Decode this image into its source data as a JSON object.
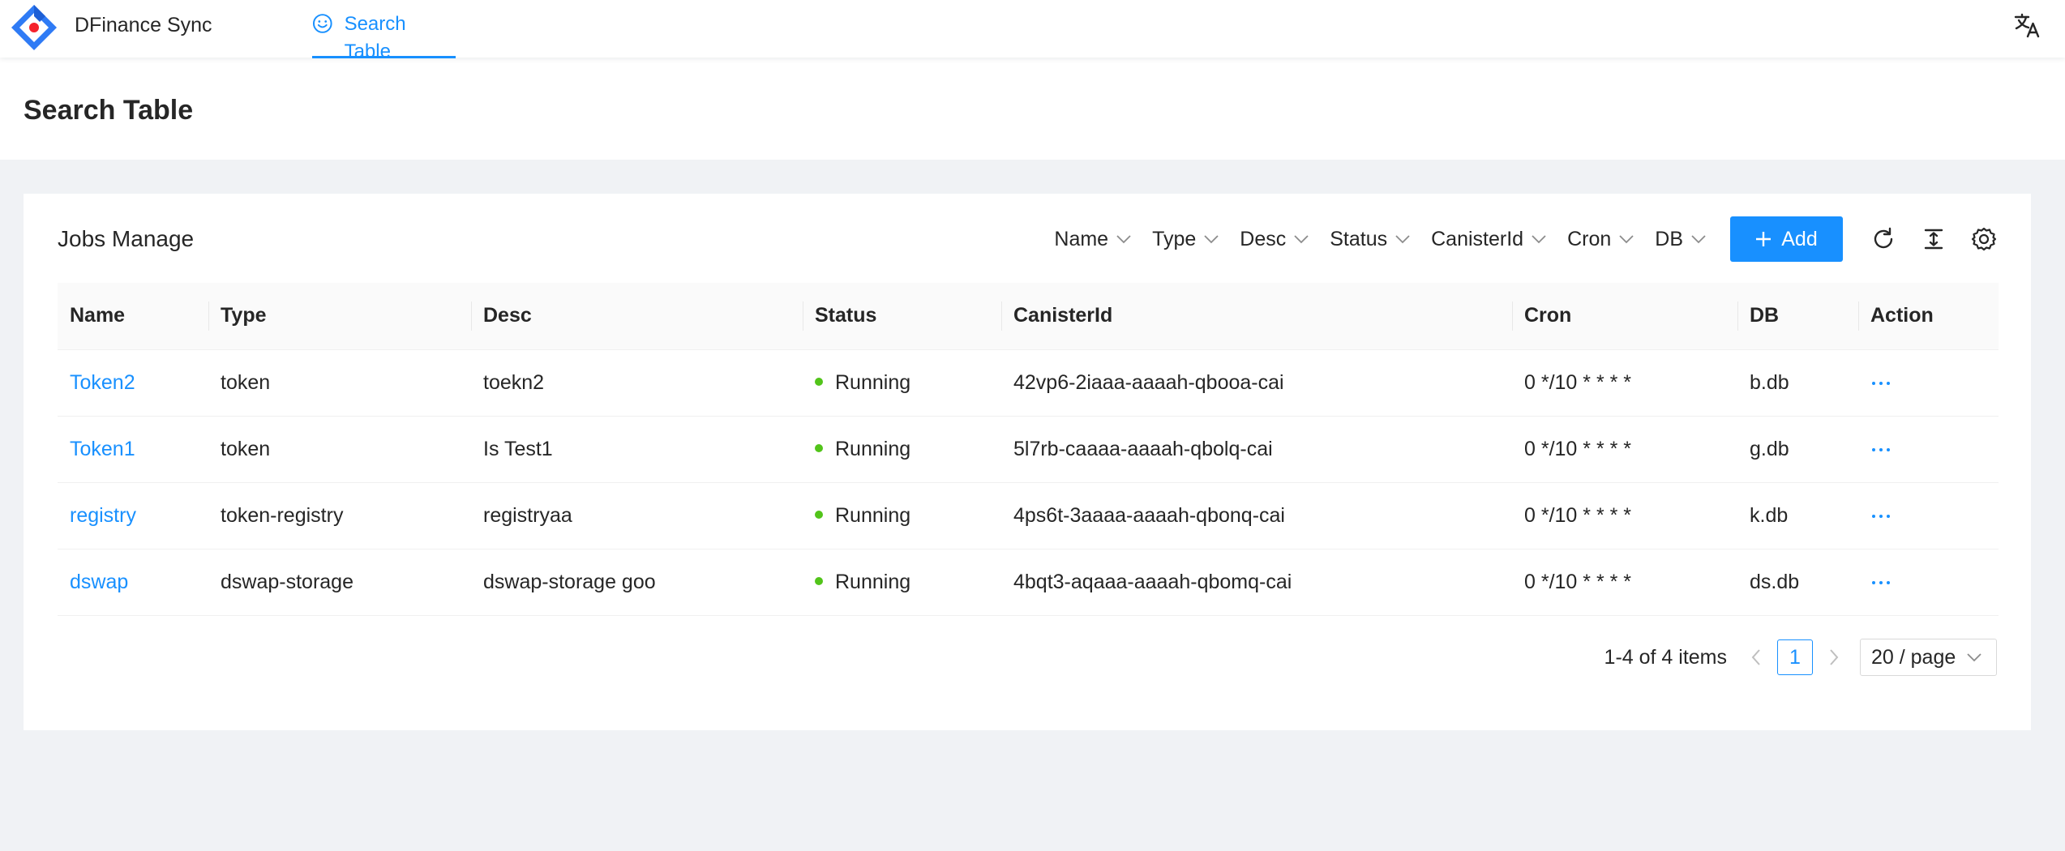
{
  "app": {
    "title": "DFinance Sync"
  },
  "nav": {
    "tabs": [
      {
        "label": "Search Table",
        "icon": "smile-icon",
        "active": true
      }
    ]
  },
  "header_actions": {
    "language_icon": "translate-icon"
  },
  "page": {
    "title": "Search Table"
  },
  "card": {
    "title": "Jobs Manage",
    "filters": [
      "Name",
      "Type",
      "Desc",
      "Status",
      "CanisterId",
      "Cron",
      "DB"
    ],
    "add_label": "Add",
    "tool_icons": [
      "reload-icon",
      "column-height-icon",
      "setting-icon"
    ]
  },
  "table": {
    "columns": [
      "Name",
      "Type",
      "Desc",
      "Status",
      "CanisterId",
      "Cron",
      "DB",
      "Action"
    ],
    "rows": [
      {
        "name": "Token2",
        "type": "token",
        "desc": "toekn2",
        "status": "Running",
        "canister": "42vp6-2iaaa-aaaah-qbooa-cai",
        "cron": "0 */10 * * * *",
        "db": "b.db"
      },
      {
        "name": "Token1",
        "type": "token",
        "desc": "Is Test1",
        "status": "Running",
        "canister": "5l7rb-caaaa-aaaah-qbolq-cai",
        "cron": "0 */10 * * * *",
        "db": "g.db"
      },
      {
        "name": "registry",
        "type": "token-registry",
        "desc": "registryaa",
        "status": "Running",
        "canister": "4ps6t-3aaaa-aaaah-qbonq-cai",
        "cron": "0 */10 * * * *",
        "db": "k.db"
      },
      {
        "name": "dswap",
        "type": "dswap-storage",
        "desc": "dswap-storage goo",
        "status": "Running",
        "canister": "4bqt3-aqaaa-aaaah-qbomq-cai",
        "cron": "0 */10 * * * *",
        "db": "ds.db"
      }
    ]
  },
  "pagination": {
    "total_text": "1-4 of 4 items",
    "current_page": "1",
    "page_size": "20 / page"
  },
  "colors": {
    "primary": "#1890ff",
    "status_running": "#52c41a",
    "background": "#f0f2f5"
  }
}
